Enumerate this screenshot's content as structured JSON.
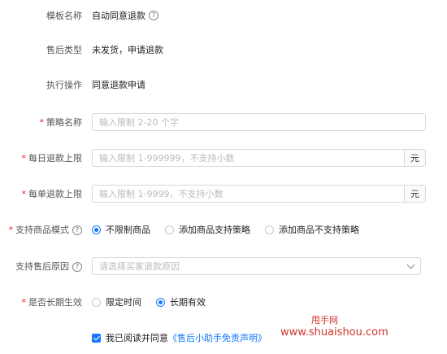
{
  "template": {
    "label": "模板名称",
    "value": "自动同意退款",
    "help_icon": "question-icon"
  },
  "after_sale_type": {
    "label": "售后类型",
    "value": "未发货，申请退款"
  },
  "action": {
    "label": "执行操作",
    "value": "同意退款申请"
  },
  "policy_name": {
    "label": "策略名称",
    "required_mark": "*",
    "placeholder": "输入限制 2-20 个字"
  },
  "daily_limit": {
    "label": "每日退款上限",
    "required_mark": "*",
    "placeholder": "输入限制 1-999999，不支持小数",
    "suffix": "元"
  },
  "single_limit": {
    "label": "每单退款上限",
    "required_mark": "*",
    "placeholder": "输入限制 1-9999，不支持小数",
    "suffix": "元"
  },
  "product_mode": {
    "label": "支持商品模式",
    "required_mark": "*",
    "help_icon": "question-icon",
    "options": [
      "不限制商品",
      "添加商品支持策略",
      "添加商品不支持策略"
    ],
    "selected": "不限制商品"
  },
  "reason": {
    "label": "支持售后原因",
    "help_icon": "question-icon",
    "placeholder": "请选择买家退款原因"
  },
  "long_term": {
    "label": "是否长期生效",
    "required_mark": "*",
    "options": [
      "限定时间",
      "长期有效"
    ],
    "selected": "长期有效"
  },
  "agreement": {
    "prefix": "我已阅读并同意",
    "link": "《售后小助手免责声明》",
    "checked": true
  },
  "watermark": {
    "line1": "甩手网",
    "line2": "www.shuaishou.com"
  },
  "colors": {
    "accent": "#1677ff",
    "required": "#f5222d",
    "watermark": "#d0352a"
  }
}
